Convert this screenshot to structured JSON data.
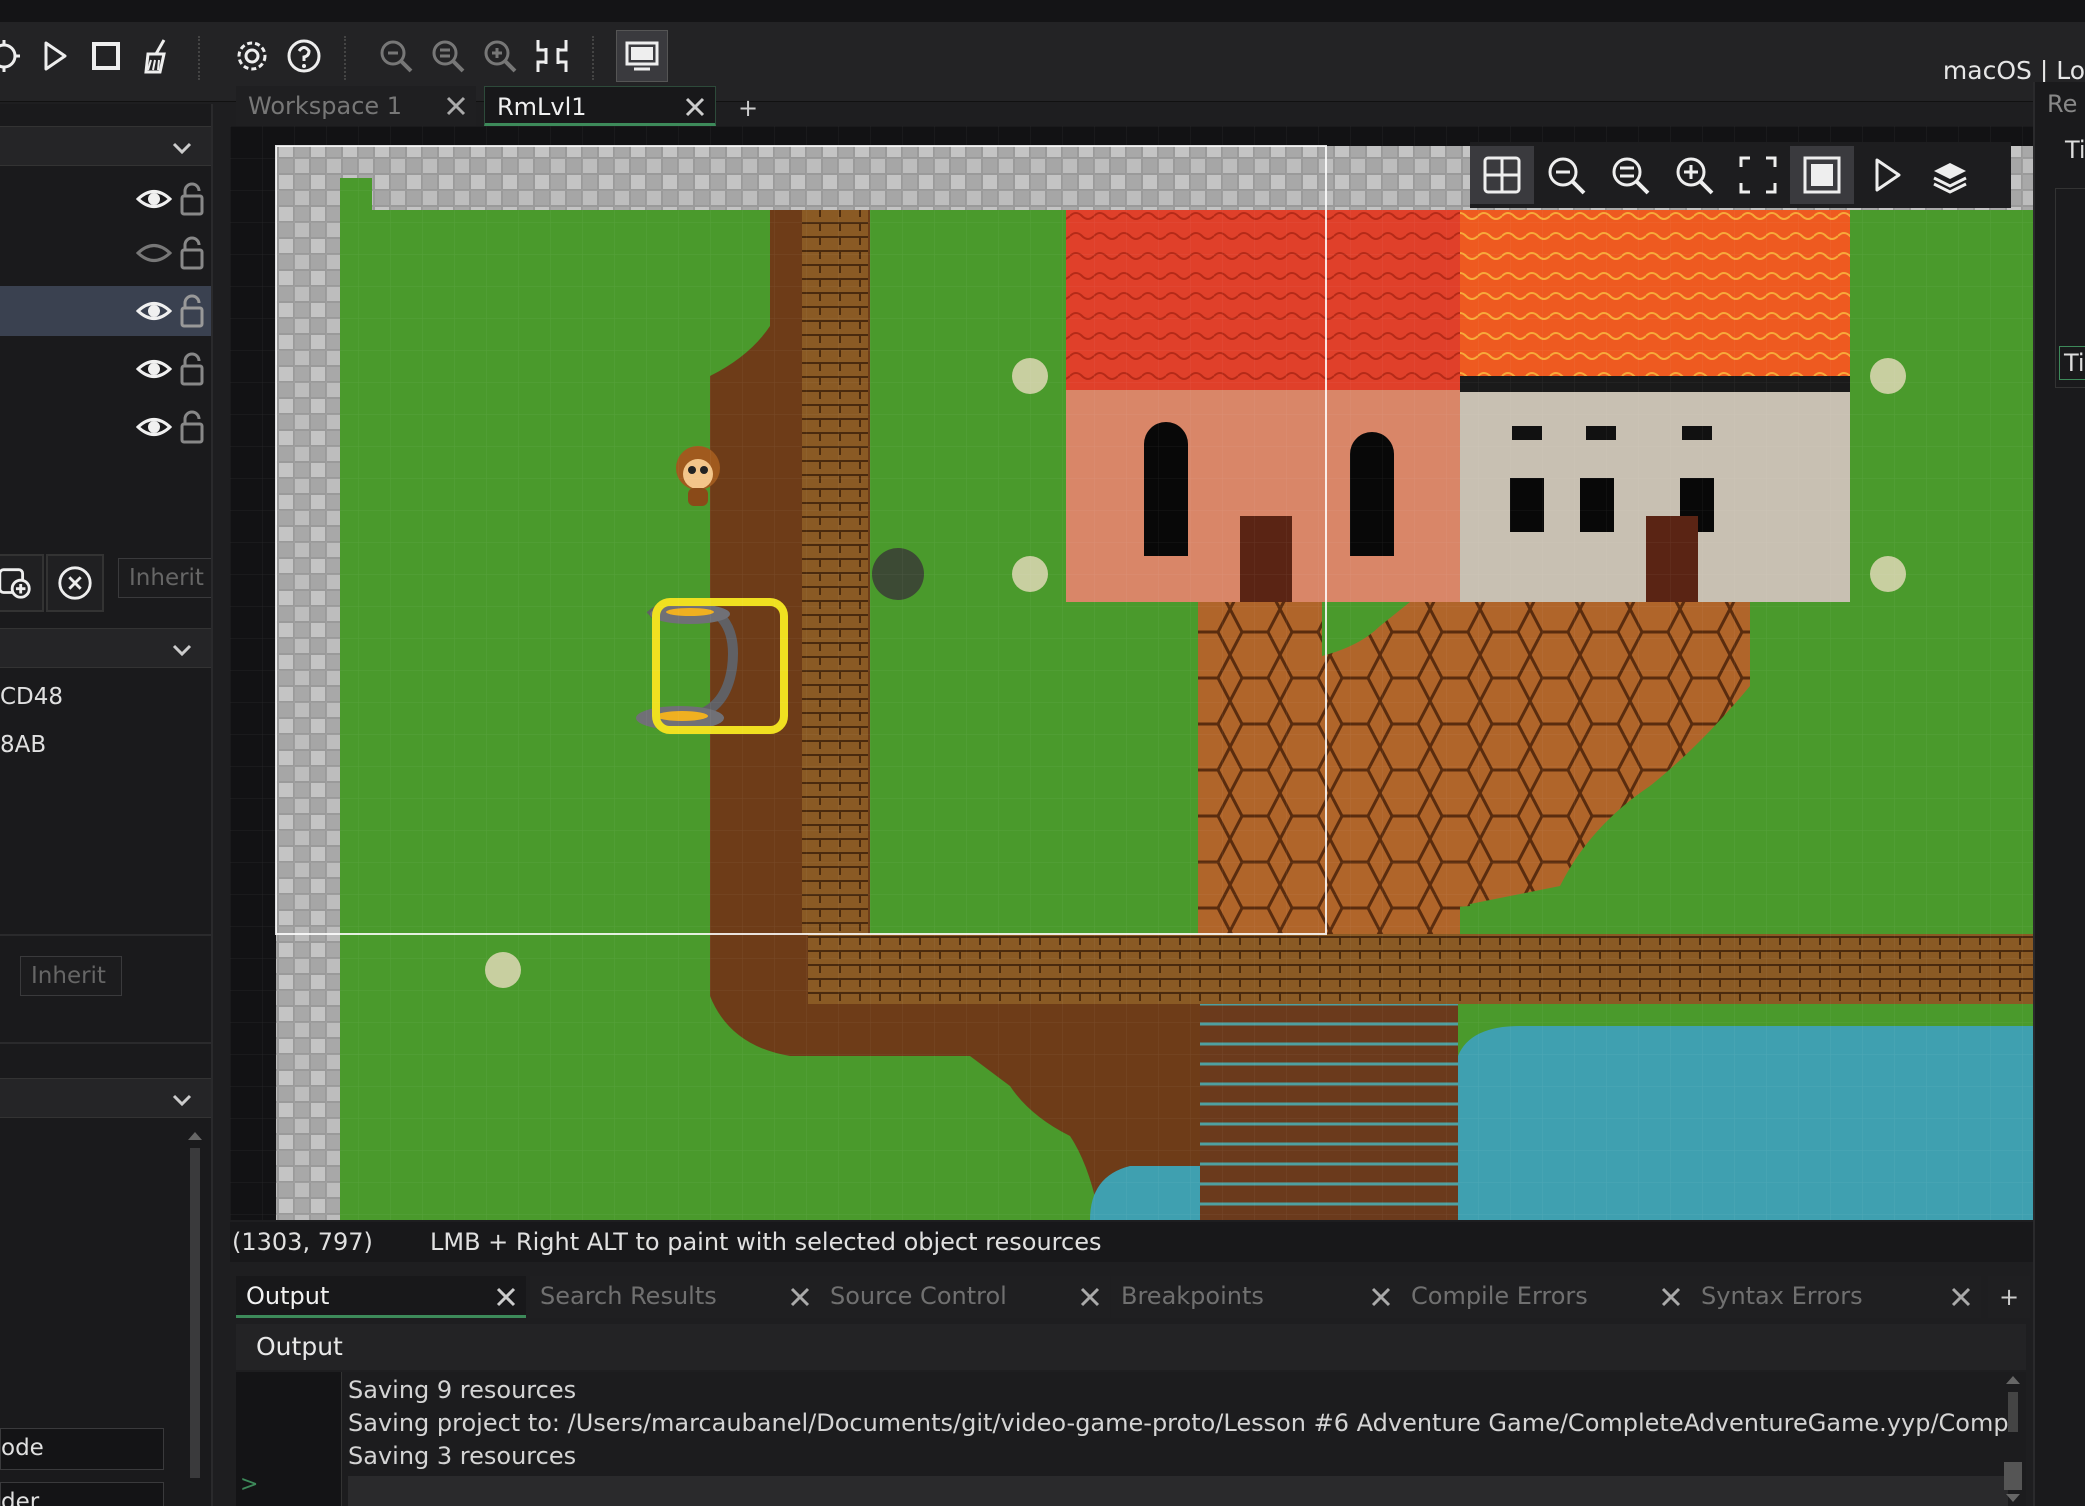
{
  "target": {
    "label": "macOS | Lo"
  },
  "toolbar": {
    "icons": [
      "clean-icon",
      "run-icon",
      "stop-icon",
      "broom-icon",
      "settings-icon",
      "help-icon",
      "zoom-out-icon",
      "zoom-reset-icon",
      "zoom-in-icon",
      "fit-icon",
      "window-icon"
    ]
  },
  "left_panel": {
    "layers": [
      {
        "visible": true,
        "selected": false
      },
      {
        "visible": false,
        "selected": false
      },
      {
        "visible": true,
        "selected": true
      },
      {
        "visible": true,
        "selected": false
      },
      {
        "visible": true,
        "selected": false
      }
    ],
    "inherit_label_1": "Inherit",
    "value_1": "CD48",
    "value_2": "8AB",
    "inherit_label_2": "Inherit",
    "field_1": "ode",
    "field_2": "der"
  },
  "workspace_tabs": [
    {
      "label": "Workspace 1",
      "active": false
    },
    {
      "label": "RmLvl1",
      "active": true
    }
  ],
  "workspace_add": "+",
  "right_panel": {
    "tab_1": "Re",
    "tab_2": "Ti",
    "tab_3": "Ti"
  },
  "room": {
    "toolbar_icons": [
      "grid-icon",
      "zoom-out-icon",
      "zoom-reset-icon",
      "zoom-in-icon",
      "fullscreen-icon",
      "frame-icon",
      "play-icon",
      "layers-icon"
    ]
  },
  "status": {
    "coords": "(1303, 797)",
    "hint": "LMB + Right ALT to paint with selected object resources"
  },
  "output_tabs": [
    {
      "label": "Output",
      "active": true
    },
    {
      "label": "Search Results",
      "active": false
    },
    {
      "label": "Source Control",
      "active": false
    },
    {
      "label": "Breakpoints",
      "active": false
    },
    {
      "label": "Compile Errors",
      "active": false
    },
    {
      "label": "Syntax Errors",
      "active": false
    }
  ],
  "output_add": "+",
  "output": {
    "title": "Output",
    "lines": [
      "Saving 9 resources",
      "Saving project to: /Users/marcaubanel/Documents/git/video-game-proto/Lesson #6 Adventure Game/CompleteAdventureGame.yyp/CompleteAdven",
      "Saving 3 resources"
    ],
    "prompt": ">"
  },
  "colors": {
    "grass": "#4a9a2c",
    "dirt": "#6a3a14",
    "roof": "#e04028",
    "water": "#3fa0b0",
    "selection": "#f0e020",
    "accent": "#3d8a5a"
  }
}
